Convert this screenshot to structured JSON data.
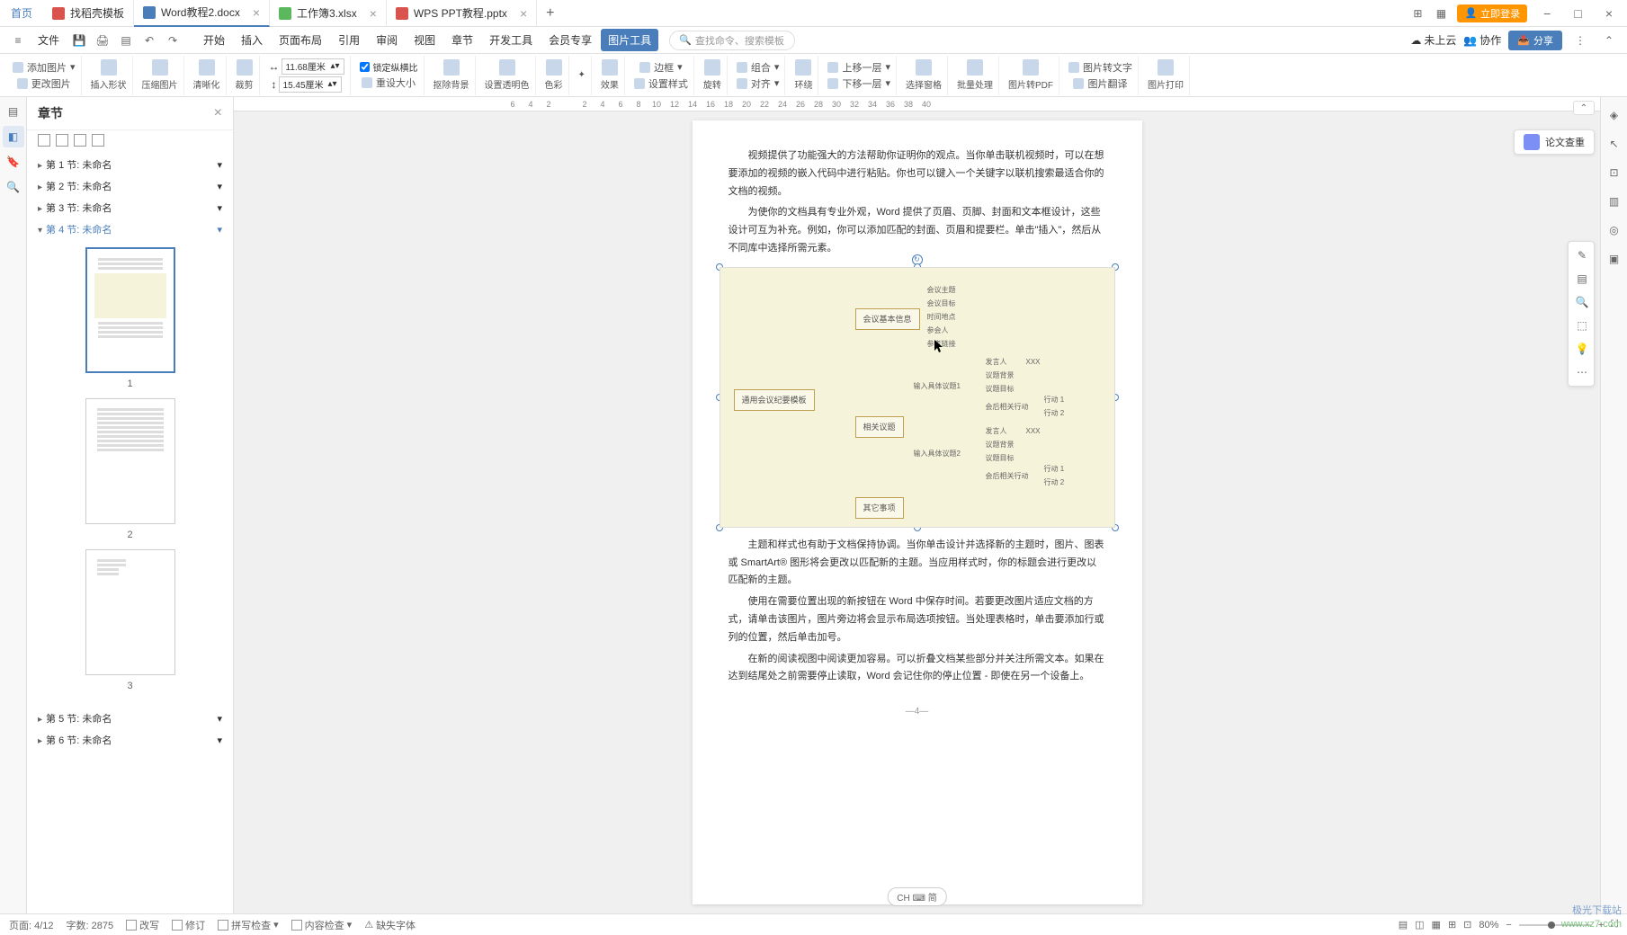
{
  "titlebar": {
    "home": "首页",
    "tabs": [
      {
        "icon": "template",
        "label": "找稻壳模板"
      },
      {
        "icon": "word",
        "label": "Word教程2.docx",
        "active": true
      },
      {
        "icon": "excel",
        "label": "工作簿3.xlsx"
      },
      {
        "icon": "ppt",
        "label": "WPS PPT教程.pptx"
      }
    ],
    "login": "立即登录"
  },
  "menubar": {
    "file": "文件",
    "items": [
      "开始",
      "插入",
      "页面布局",
      "引用",
      "审阅",
      "视图",
      "章节",
      "开发工具",
      "会员专享",
      "图片工具"
    ],
    "active_index": 9,
    "search_placeholder": "查找命令、搜索模板",
    "cloud": "未上云",
    "collab": "协作",
    "share": "分享"
  },
  "ribbon": {
    "add_pic": "添加图片",
    "change_pic": "更改图片",
    "insert_shape": "插入形状",
    "compress": "压缩图片",
    "sharpen": "清晰化",
    "crop": "裁剪",
    "width_icon": "↔",
    "height_icon": "↕",
    "width": "11.68厘米",
    "height": "15.45厘米",
    "lock_ratio": "锁定纵横比",
    "reset_size": "重设大小",
    "remove_bg": "抠除背景",
    "set_transparent": "设置透明色",
    "color": "色彩",
    "effect_adjust": "✦",
    "effect": "效果",
    "border": "边框",
    "set_style": "设置样式",
    "rotate": "旋转",
    "group": "组合",
    "align": "对齐",
    "wrap": "环绕",
    "move_up": "上移一层",
    "move_down": "下移一层",
    "select_pane": "选择窗格",
    "batch": "批量处理",
    "to_pdf": "图片转PDF",
    "to_text": "图片转文字",
    "translate": "图片翻译",
    "print": "图片打印"
  },
  "chapter": {
    "title": "章节",
    "items": [
      {
        "label": "第 1 节: 未命名"
      },
      {
        "label": "第 2 节: 未命名"
      },
      {
        "label": "第 3 节: 未命名"
      },
      {
        "label": "第 4 节: 未命名",
        "active": true
      },
      {
        "label": "第 5 节: 未命名"
      },
      {
        "label": "第 6 节: 未命名"
      }
    ],
    "thumb_labels": [
      "1",
      "2",
      "3"
    ]
  },
  "ruler": [
    "6",
    "4",
    "2",
    "",
    "2",
    "4",
    "6",
    "8",
    "10",
    "12",
    "14",
    "16",
    "18",
    "20",
    "22",
    "24",
    "26",
    "28",
    "30",
    "32",
    "34",
    "36",
    "38",
    "40"
  ],
  "document": {
    "p1": "视频提供了功能强大的方法帮助你证明你的观点。当你单击联机视频时，可以在想要添加的视频的嵌入代码中进行粘贴。你也可以键入一个关键字以联机搜索最适合你的文档的视频。",
    "p2": "为使你的文档具有专业外观，Word 提供了页眉、页脚、封面和文本框设计，这些设计可互为补充。例如，你可以添加匹配的封面、页眉和提要栏。单击\"插入\"，然后从不同库中选择所需元素。",
    "p3": "主题和样式也有助于文档保持协调。当你单击设计并选择新的主题时，图片、图表或 SmartArt® 图形将会更改以匹配新的主题。当应用样式时，你的标题会进行更改以匹配新的主题。",
    "p4": "使用在需要位置出现的新按钮在 Word 中保存时间。若要更改图片适应文档的方式，请单击该图片，图片旁边将会显示布局选项按钮。当处理表格时，单击要添加行或列的位置，然后单击加号。",
    "p5": "在新的阅读视图中阅读更加容易。可以折叠文档某些部分并关注所需文本。如果在达到结尾处之前需要停止读取，Word 会记住你的停止位置 - 即使在另一个设备上。",
    "page_num": "—4—"
  },
  "mindmap": {
    "root": "通用会议纪要模板",
    "n1": "会议基本信息",
    "n2": "相关议题",
    "n3": "其它事项",
    "leaves1": [
      "会议主题",
      "会议目标",
      "时间地点",
      "参会人",
      "参考链接"
    ],
    "body1": "输入具体议题1",
    "body2": "输入具体议题2",
    "sub": [
      "发言人",
      "议题背景",
      "议题目标",
      "会后相关行动"
    ],
    "xxx": "XXX",
    "act1": "行动 1",
    "act2": "行动 2"
  },
  "float_check": "论文查重",
  "statusbar": {
    "page": "页面: 4/12",
    "words": "字数: 2875",
    "rewrite": "改写",
    "revise": "修订",
    "spell": "拼写检查",
    "content": "内容检查",
    "font": "缺失字体",
    "ime": "CH ⌨ 简",
    "zoom": "80%"
  },
  "watermark1": "www.xz7.com",
  "watermark2": "极光下载站"
}
